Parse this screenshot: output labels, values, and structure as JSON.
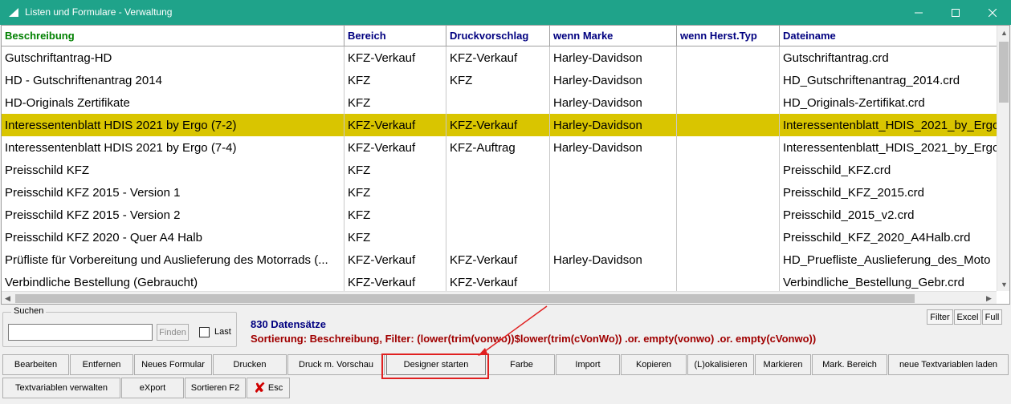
{
  "window": {
    "title": "Listen und Formulare - Verwaltung",
    "minimize_icon": "minimize-icon",
    "maximize_icon": "maximize-icon",
    "close_icon": "close-icon",
    "titlebar_color": "#1fa38a"
  },
  "grid": {
    "columns": [
      "Beschreibung",
      "Bereich",
      "Druckvorschlag",
      "wenn Marke",
      "wenn Herst.Typ",
      "Dateiname"
    ],
    "rows": [
      [
        "Gutschriftantrag-HD",
        "KFZ-Verkauf",
        "KFZ-Verkauf",
        "Harley-Davidson",
        "",
        "Gutschriftantrag.crd"
      ],
      [
        "HD - Gutschriftenantrag 2014",
        "KFZ",
        "KFZ",
        "Harley-Davidson",
        "",
        "HD_Gutschriftenantrag_2014.crd"
      ],
      [
        "HD-Originals Zertifikate",
        "KFZ",
        "",
        "Harley-Davidson",
        "",
        "HD_Originals-Zertifikat.crd"
      ],
      [
        "Interessentenblatt HDIS 2021 by Ergo (7-2)",
        "KFZ-Verkauf",
        "KFZ-Verkauf",
        "Harley-Davidson",
        "",
        "Interessentenblatt_HDIS_2021_by_Ergo"
      ],
      [
        "Interessentenblatt HDIS 2021 by Ergo (7-4)",
        "KFZ-Verkauf",
        "KFZ-Auftrag",
        "Harley-Davidson",
        "",
        "Interessentenblatt_HDIS_2021_by_Ergo"
      ],
      [
        "Preisschild KFZ",
        "KFZ",
        "",
        "",
        "",
        "Preisschild_KFZ.crd"
      ],
      [
        "Preisschild KFZ 2015 - Version 1",
        "KFZ",
        "",
        "",
        "",
        "Preisschild_KFZ_2015.crd"
      ],
      [
        "Preisschild KFZ 2015 - Version 2",
        "KFZ",
        "",
        "",
        "",
        "Preisschild_2015_v2.crd"
      ],
      [
        "Preisschild KFZ 2020 - Quer A4 Halb",
        "KFZ",
        "",
        "",
        "",
        "Preisschild_KFZ_2020_A4Halb.crd"
      ],
      [
        "Prüfliste für Vorbereitung und Auslieferung des Motorrads (...",
        "KFZ-Verkauf",
        "KFZ-Verkauf",
        "Harley-Davidson",
        "",
        "HD_Pruefliste_Auslieferung_des_Moto"
      ],
      [
        "Verbindliche Bestellung (Gebraucht)",
        "KFZ-Verkauf",
        "KFZ-Verkauf",
        "",
        "",
        "Verbindliche_Bestellung_Gebr.crd"
      ]
    ],
    "selected_row": 3,
    "selected_color": "#d9c500"
  },
  "search": {
    "legend": "Suchen",
    "value": "",
    "finden_label": "Finden",
    "last_label": "Last",
    "last_checked": false
  },
  "status": {
    "count": "830 Datensätze",
    "sort_info": "Sortierung: Beschreibung, Filter: (lower(trim(vonwo))$lower(trim(cVonWo))  .or. empty(vonwo) .or. empty(cVonwo))"
  },
  "export_buttons": [
    "Filter",
    "Excel",
    "Full"
  ],
  "buttons_row1": [
    "Bearbeiten",
    "Entfernen",
    "Neues Formular",
    "Drucken",
    "Druck m. Vorschau",
    "Designer starten",
    "Farbe",
    "Import",
    "Kopieren",
    "(L)okalisieren",
    "Markieren",
    "Mark. Bereich",
    "neue Textvariablen laden"
  ],
  "buttons_row2": [
    "Textvariablen verwalten",
    "eXport",
    "Sortieren F2",
    "Esc"
  ]
}
